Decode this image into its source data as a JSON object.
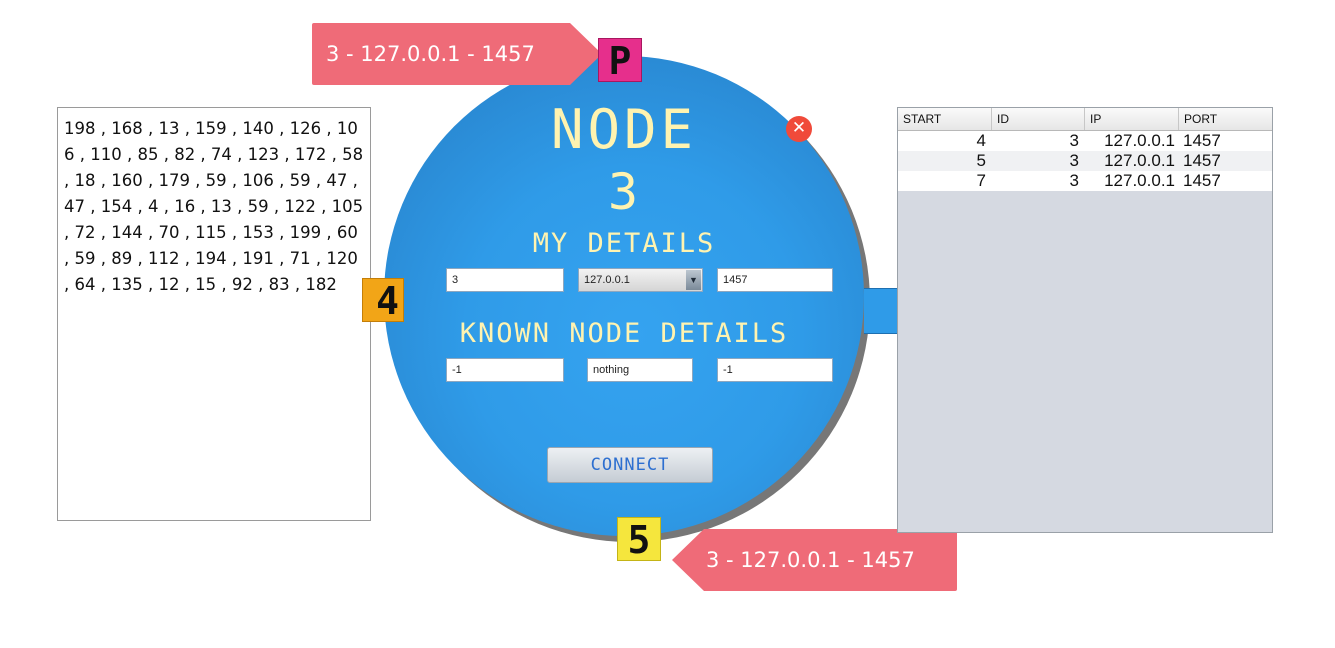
{
  "numbers": {
    "text": "198 , 168 , 13 , 159 , 140 , 126 , 106 , 110 , 85 , 82 , 74 , 123 , 172 , 58 , 18 , 160 , 179 , 59 , 106 , 59 , 47 , 47 , 154 , 4 , 16 , 13 , 59 , 122 , 105 , 72 , 144 , 70 , 115 , 153 , 199 , 60 , 59 , 89 , 112 , 194 , 191 , 71 , 120 , 64 , 135 , 12 , 15 , 92 , 83 , 182"
  },
  "callouts": {
    "top": "3 - 127.0.0.1 - 1457",
    "bottom": "3 - 127.0.0.1 - 1457"
  },
  "badges": {
    "predecessor": "P",
    "left": "4",
    "successor": "5"
  },
  "node": {
    "title": "NODE",
    "number": "3",
    "my_details_label": "MY DETAILS",
    "my_details": {
      "id": "3",
      "ip_selected": "127.0.0.1",
      "port": "1457"
    },
    "known_label": "KNOWN NODE DETAILS",
    "known_details": {
      "id": "-1",
      "ip": "nothing",
      "port": "-1"
    },
    "connect_label": "CONNECT",
    "close_symbol": "✕"
  },
  "icons": {
    "close": "close-icon",
    "dropdown": "chevron-down-icon"
  },
  "colors": {
    "node_blue": "#2f9be8",
    "callout": "#ef6b78",
    "badge_p": "#e62f8c",
    "badge_4": "#f2a517",
    "badge_5": "#f5e63d",
    "lcd_text": "#fff3b0",
    "close": "#f04a3a"
  },
  "finger_table": {
    "headers": [
      "START",
      "ID",
      "IP",
      "PORT"
    ],
    "rows": [
      {
        "start": "4",
        "id": "3",
        "ip": "127.0.0.1",
        "port": "1457"
      },
      {
        "start": "5",
        "id": "3",
        "ip": "127.0.0.1",
        "port": "1457"
      },
      {
        "start": "7",
        "id": "3",
        "ip": "127.0.0.1",
        "port": "1457"
      }
    ]
  }
}
